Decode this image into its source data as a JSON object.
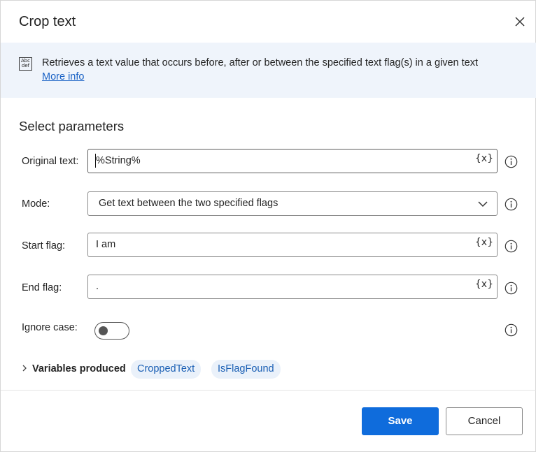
{
  "dialog": {
    "title": "Crop text",
    "description": "Retrieves a text value that occurs before, after or between the specified text flag(s) in a given text",
    "more_info": "More info",
    "icon_text": [
      "Abc",
      "def"
    ]
  },
  "section": {
    "title": "Select parameters"
  },
  "fields": {
    "original_text": {
      "label": "Original text:",
      "value": "%String%",
      "var_button": "{x}"
    },
    "mode": {
      "label": "Mode:",
      "value": "Get text between the two specified flags"
    },
    "start_flag": {
      "label": "Start flag:",
      "value": "I am",
      "var_button": "{x}"
    },
    "end_flag": {
      "label": "End flag:",
      "value": ".",
      "var_button": "{x}"
    },
    "ignore_case": {
      "label": "Ignore case:",
      "enabled": false
    }
  },
  "variables": {
    "label": "Variables produced",
    "items": [
      "CroppedText",
      "IsFlagFound"
    ]
  },
  "buttons": {
    "save": "Save",
    "cancel": "Cancel"
  },
  "colors": {
    "primary": "#0f6cdc",
    "info_band": "#eff4fb",
    "link": "#1a62c5",
    "pill_bg": "#eaf1fa"
  }
}
